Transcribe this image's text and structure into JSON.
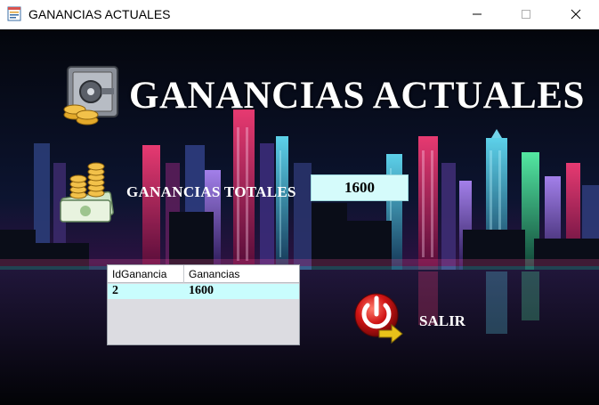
{
  "window": {
    "title": "GANANCIAS ACTUALES"
  },
  "header": {
    "title": "GANANCIAS ACTUALES"
  },
  "totals": {
    "label": "GANANCIAS TOTALES",
    "value": "1600"
  },
  "table": {
    "columns": [
      "IdGanancia",
      "Ganancias"
    ],
    "rows": [
      [
        "2",
        "1600"
      ]
    ]
  },
  "actions": {
    "exit_label": "SALIR"
  },
  "icons": {
    "app": "app-document-icon",
    "safe": "safe-with-coins-icon",
    "money": "coins-and-cash-icon",
    "exit": "power-exit-icon"
  },
  "colors": {
    "field_bg": "#d5fbfb",
    "row_bg": "#c9fdfd",
    "background": "#05070d"
  }
}
